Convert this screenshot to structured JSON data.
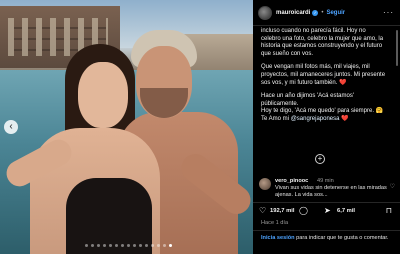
{
  "post": {
    "username": "mauroicardi",
    "separator": "•",
    "follow_label": "Seguir",
    "more_icon": "more-icon"
  },
  "caption": {
    "p1": "incluso cuando no parecía fácil. Hoy no celebro una foto, celebro la mujer que amo, la historia que estamos construyendo y el futuro que sueño con vos.",
    "p2": "Que vengan mil fotos más, mil viajes, mil proyectos, mil amaneceres juntos. Mi presente sos vos, y mi futuro también. ❤️",
    "p3_a": "Hace un año dijimos 'Acá estamos' públicamente.",
    "p3_b": "Hoy te digo, 'Acá me quedo' para siempre. 🤗",
    "p3_c_prefix": "Te Amo mi",
    "p3_c_mention": "@sangrejaponesa",
    "p3_c_suffix": "❤️"
  },
  "comment": {
    "username": "vero_pinooc",
    "time": "49 min",
    "text": "Vivan sus vidas sin detenerse en las miradas ajenas. La vida sos..."
  },
  "actions": {
    "likes": "192,7 mil",
    "shares": "6,7 mil"
  },
  "date": "Hace 1 día",
  "login": {
    "link": "Inicia sesión",
    "text": " para indicar que te gusta o comentar."
  },
  "carousel": {
    "slides": 15,
    "active": 14
  }
}
